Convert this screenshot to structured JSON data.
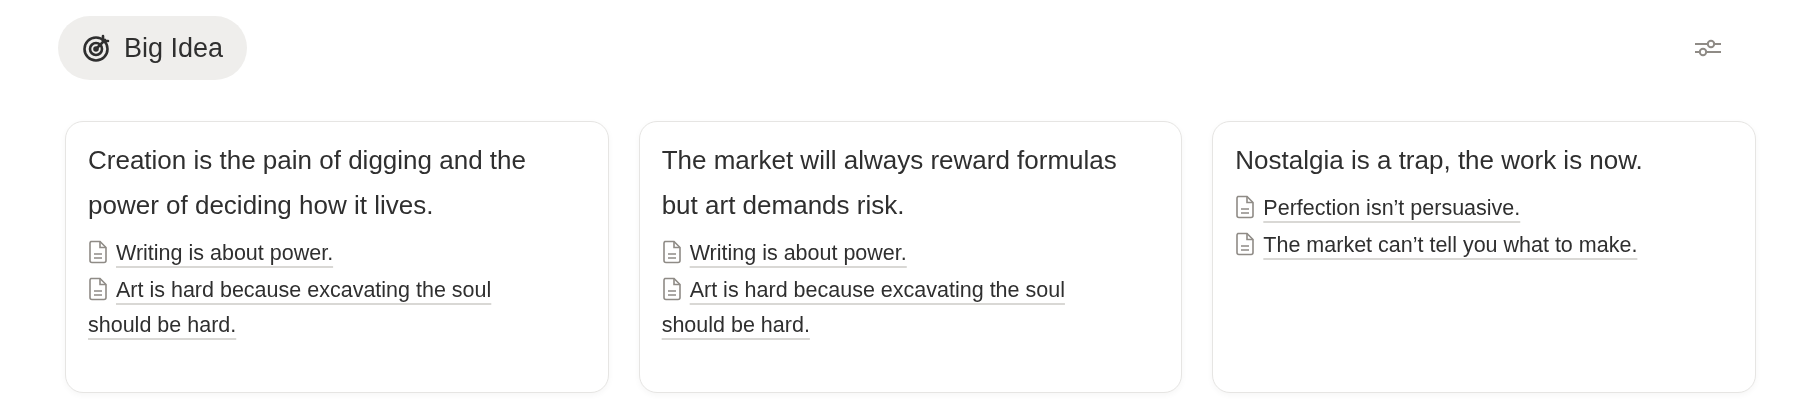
{
  "header": {
    "label": "Big Idea"
  },
  "cards": [
    {
      "title": "Creation is the pain of digging and the power of deciding how it lives.",
      "links": [
        "Writing is about power.",
        "Art is hard because excavating the soul should be hard."
      ]
    },
    {
      "title": "The market will always reward formulas but art demands risk.",
      "links": [
        "Writing is about power.",
        "Art is hard because excavating the soul should be hard."
      ]
    },
    {
      "title": "Nostalgia is a trap, the work is now.",
      "links": [
        "Perfection isn’t persuasive.",
        "The market can’t tell you what to make."
      ]
    }
  ]
}
